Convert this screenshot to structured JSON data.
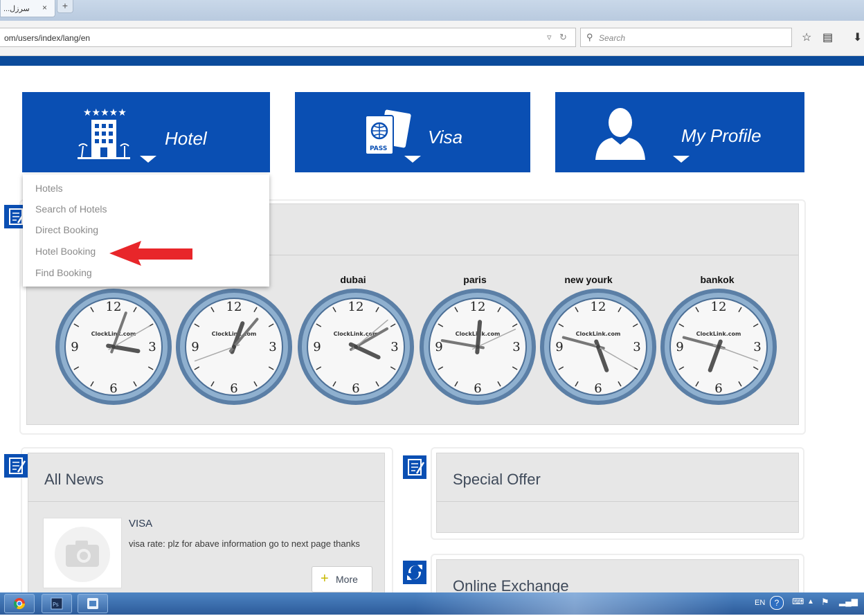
{
  "browser": {
    "tab_title": "...سرزل",
    "tab_close": "×",
    "new_tab": "+",
    "url": "om/users/index/lang/en",
    "search_placeholder": "Search"
  },
  "tiles": [
    {
      "label": "Hotel",
      "icon": "hotel-icon"
    },
    {
      "label": "Visa",
      "icon": "passport-icon"
    },
    {
      "label": "My Profile",
      "icon": "user-icon"
    }
  ],
  "dropdown": {
    "items": [
      "Hotels",
      "Search of Hotels",
      "Direct Booking",
      "Hotel Booking",
      "Find Booking"
    ]
  },
  "clocks": {
    "cities": [
      "",
      "",
      "dubai",
      "paris",
      "new yourk",
      "bankok"
    ],
    "brand": "ClockLink.com",
    "numerals": [
      "12",
      "3",
      "6",
      "9"
    ]
  },
  "news": {
    "title": "All News",
    "item_title": "VISA",
    "item_text": "visa rate: plz for abave information go to next page thanks",
    "more_label": "More"
  },
  "offer": {
    "title": "Special Offer"
  },
  "exchange": {
    "title": "Online Exchange"
  },
  "taskbar": {
    "lang": "EN"
  },
  "colors": {
    "brand_blue": "#0a4fb3",
    "nav_blue": "#0b4b9b",
    "panel_gray": "#e7e7e7",
    "arrow_red": "#e8262a"
  }
}
